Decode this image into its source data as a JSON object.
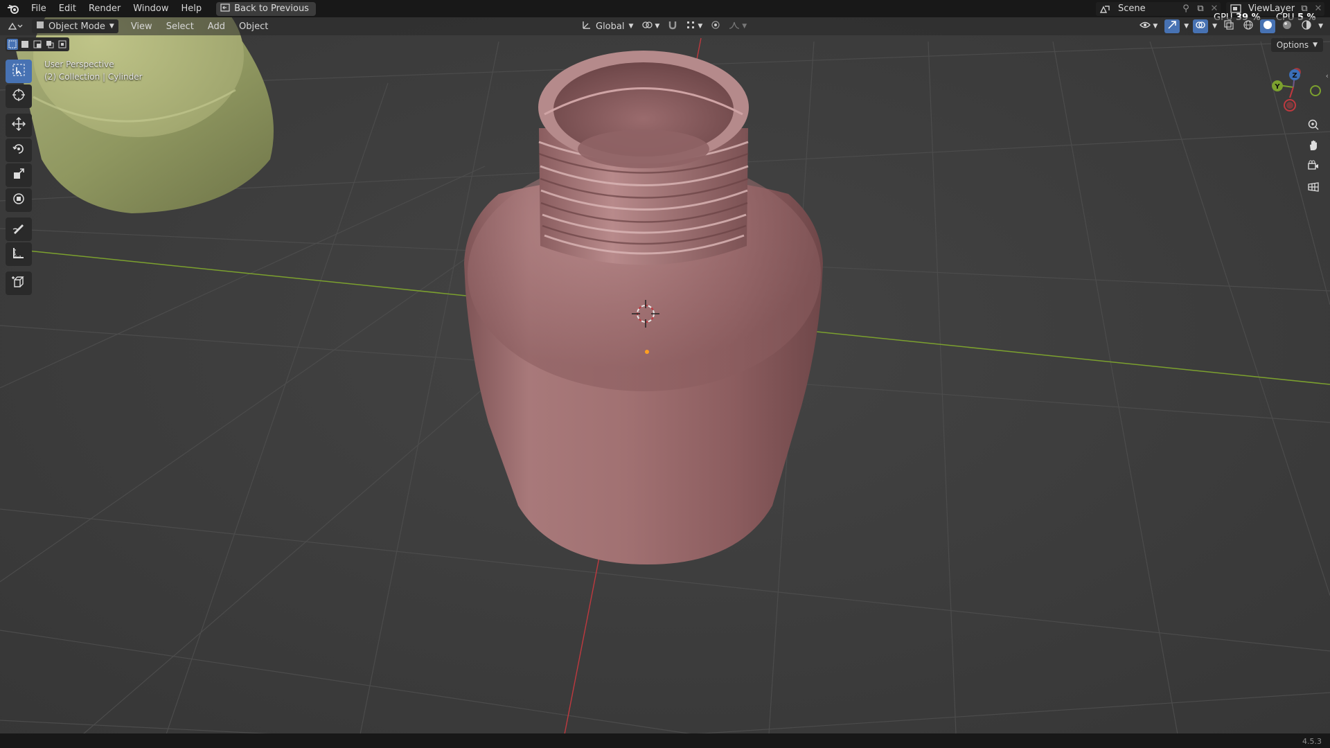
{
  "menubar": {
    "items": [
      "File",
      "Edit",
      "Render",
      "Window",
      "Help"
    ],
    "back_button": "Back to Previous"
  },
  "top_right": {
    "scene_name": "Scene",
    "view_layer_name": "ViewLayer",
    "gpu_label": "GPU",
    "gpu_value": "39 %",
    "cpu_label": "CPU",
    "cpu_value": "5 %"
  },
  "viewport_header": {
    "mode": "Object Mode",
    "menus": [
      "View",
      "Select",
      "Add",
      "Object"
    ],
    "transform_orientation": "Global"
  },
  "overlay": {
    "view_name": "User Perspective",
    "collection_info": "(2) Collection | Cylinder"
  },
  "options_label": "Options",
  "gizmo": {
    "z": "Z",
    "y": "Y"
  },
  "version": "4.5.3",
  "colors": {
    "bottle": "#9a6a6a",
    "cap": "#97a06a",
    "active_tool": "#4772b3",
    "x_axis": "#c0393f",
    "y_axis": "#7ca12e"
  },
  "icons": {
    "tools": [
      "select-box-icon",
      "cursor-icon",
      "move-icon",
      "rotate-icon",
      "scale-icon",
      "transform-icon",
      "annotate-icon",
      "measure-icon",
      "add-cube-icon"
    ],
    "nav": [
      "zoom-icon",
      "pan-icon",
      "camera-icon",
      "ortho-grid-icon"
    ]
  }
}
